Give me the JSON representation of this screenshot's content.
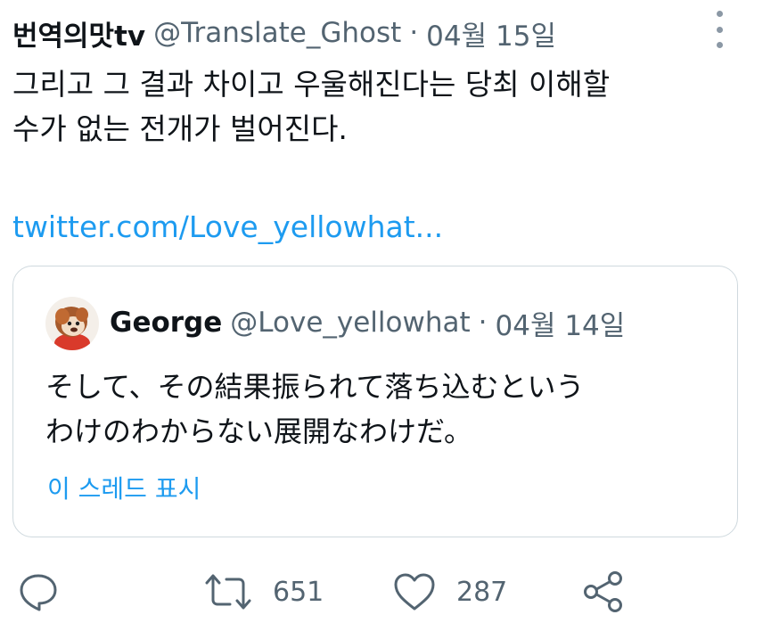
{
  "tweet": {
    "author_name": "번역의맛tv",
    "author_handle": "@Translate_Ghost",
    "separator": "·",
    "date": "04월 15일",
    "text_lines": [
      "그리고 그 결과 차이고 우울해진다는 당최 이해할",
      "수가 없는 전개가 벌어진다."
    ],
    "link": "twitter.com/Love_yellowhat..."
  },
  "quote": {
    "author_name": "George",
    "author_handle": "@Love_yellowhat",
    "separator": "·",
    "date": "04월 14일",
    "text_lines": [
      "そして、その結果振られて落ち込むという",
      "わけのわからない展開なわけだ。"
    ],
    "thread_link": "이 스레드 표시"
  },
  "actions": {
    "reply_icon": "speech-bubble-icon",
    "retweet_icon": "retweet-arrows-icon",
    "retweet_count": "651",
    "like_icon": "heart-icon",
    "like_count": "287",
    "share_icon": "share-nodes-icon"
  },
  "colors": {
    "text_primary": "#0f1419",
    "text_secondary": "#536471",
    "link": "#1d9bf0",
    "border": "#cfd9de"
  }
}
